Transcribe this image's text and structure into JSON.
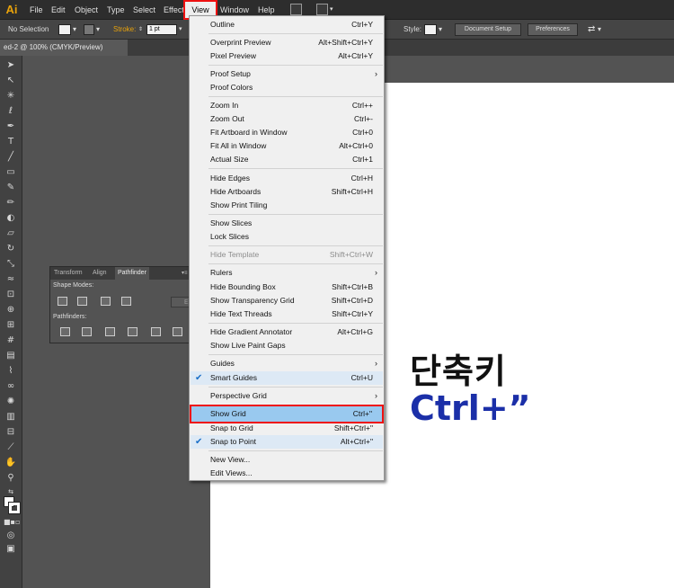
{
  "menubar": {
    "logo": "Ai",
    "items": [
      "File",
      "Edit",
      "Object",
      "Type",
      "Select",
      "Effect",
      "View",
      "Window",
      "Help"
    ],
    "active": "View"
  },
  "controlbar": {
    "selection_label": "No Selection",
    "stroke_label": "Stroke:",
    "stroke_value": "1 pt",
    "style_label": "Style:",
    "document_setup": "Document Setup",
    "preferences": "Preferences"
  },
  "doc_tab": "ed-2 @ 100% (CMYK/Preview)",
  "panel": {
    "tabs": [
      "Transform",
      "Align",
      "Pathfinder"
    ],
    "shape_modes": "Shape Modes:",
    "expand": "Expand",
    "pathfinders": "Pathfinders:"
  },
  "view_menu": {
    "items": [
      {
        "label": "Outline",
        "shortcut": "Ctrl+Y"
      },
      {
        "label": "Overprint Preview",
        "shortcut": "Alt+Shift+Ctrl+Y"
      },
      {
        "label": "Pixel Preview",
        "shortcut": "Alt+Ctrl+Y"
      },
      {
        "label": "Proof Setup",
        "shortcut": "",
        "submenu": true
      },
      {
        "label": "Proof Colors",
        "shortcut": ""
      },
      {
        "label": "Zoom In",
        "shortcut": "Ctrl++"
      },
      {
        "label": "Zoom Out",
        "shortcut": "Ctrl+-"
      },
      {
        "label": "Fit Artboard in Window",
        "shortcut": "Ctrl+0"
      },
      {
        "label": "Fit All in Window",
        "shortcut": "Alt+Ctrl+0"
      },
      {
        "label": "Actual Size",
        "shortcut": "Ctrl+1"
      },
      {
        "label": "Hide Edges",
        "shortcut": "Ctrl+H"
      },
      {
        "label": "Hide Artboards",
        "shortcut": "Shift+Ctrl+H"
      },
      {
        "label": "Show Print Tiling",
        "shortcut": ""
      },
      {
        "label": "Show Slices",
        "shortcut": ""
      },
      {
        "label": "Lock Slices",
        "shortcut": ""
      },
      {
        "label": "Hide Template",
        "shortcut": "Shift+Ctrl+W",
        "disabled": true
      },
      {
        "label": "Rulers",
        "shortcut": "",
        "submenu": true
      },
      {
        "label": "Hide Bounding Box",
        "shortcut": "Shift+Ctrl+B"
      },
      {
        "label": "Show Transparency Grid",
        "shortcut": "Shift+Ctrl+D"
      },
      {
        "label": "Hide Text Threads",
        "shortcut": "Shift+Ctrl+Y"
      },
      {
        "label": "Hide Gradient Annotator",
        "shortcut": "Alt+Ctrl+G"
      },
      {
        "label": "Show Live Paint Gaps",
        "shortcut": ""
      },
      {
        "label": "Guides",
        "shortcut": "",
        "submenu": true
      },
      {
        "label": "Smart Guides",
        "shortcut": "Ctrl+U",
        "checked": true
      },
      {
        "label": "Perspective Grid",
        "shortcut": "",
        "submenu": true
      },
      {
        "label": "Show Grid",
        "shortcut": "Ctrl+\"",
        "highlighted": true
      },
      {
        "label": "Snap to Grid",
        "shortcut": "Shift+Ctrl+\""
      },
      {
        "label": "Snap to Point",
        "shortcut": "Alt+Ctrl+\"",
        "checked": true
      },
      {
        "label": "New View...",
        "shortcut": ""
      },
      {
        "label": "Edit Views...",
        "shortcut": ""
      }
    ]
  },
  "annotation": {
    "korean": "단축키",
    "shortcut": "Ctrl+”"
  },
  "colors": {
    "highlight_border": "#e11111",
    "highlight_fill": "#99c9ef",
    "annotation_blue": "#1b2fa8",
    "logo_orange": "#e8a20b"
  }
}
